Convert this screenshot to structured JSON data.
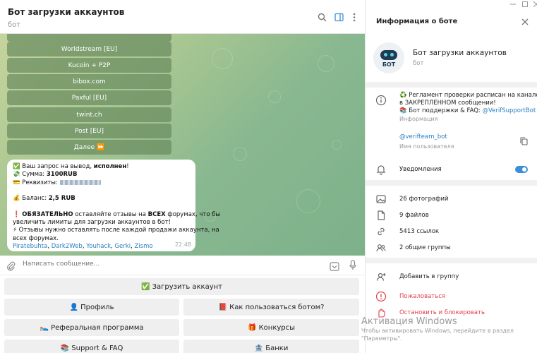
{
  "header": {
    "title": "Бот загрузки аккаунтов",
    "subtitle": "бот"
  },
  "inline_buttons": [
    "Worldstream [EU]",
    "Kucoin + P2P",
    "bibox.com",
    "Paxful [EU]",
    "twint.ch",
    "Post [EU]",
    "Далее ⏩"
  ],
  "message": {
    "line1_pre": "✅ Ваш запрос на вывод, ",
    "line1_bold": "исполнен",
    "line1_post": "!",
    "line2_pre": "💸 Сумма: ",
    "line2_bold": "3100RUB",
    "line3_pre": "💳 Реквизиты: ",
    "line4_pre": "💰 Баланс: ",
    "line4_bold": "2,5 RUB",
    "line5_pre": "❗ ",
    "line5_bold": "ОБЯЗАТЕЛЬНО",
    "line5_post": " оставляйте отзывы на ",
    "line5_bold2": "ВСЕХ",
    "line5_post2": " форумах, что бы",
    "line6": "увеличить лимиты для загрузки аккаунтов в бот!",
    "line7": "⚡ Отзывы нужно оставлять после каждой продажи аккаунта, на",
    "line8": "всех форумах.",
    "links": [
      "Piratebuhta",
      "Dark2Web",
      "Youhack",
      "Gerki",
      "Zismo"
    ],
    "time": "22:48"
  },
  "composer": {
    "placeholder": "Написать сообщение..."
  },
  "keyboard": {
    "upload": "✅ Загрузить аккаунт",
    "profile": "👤 Профиль",
    "howto": "📕 Как пользоваться ботом?",
    "referral": "🛌 Реферальная программа",
    "contests": "🎁 Конкурсы",
    "support": "📚 Support & FAQ",
    "banks": "🏦 Банки"
  },
  "info": {
    "title": "Информация о боте",
    "avatar_text": "БОТ",
    "name": "Бот загрузки аккаунтов",
    "kind": "бот",
    "about_line1": "♻️ Регламент проверки расписан на канале",
    "about_line2": "в ЗАКРЕПЛЕННОМ сообщении!",
    "about_line3_pre": "📚 Бот поддержки & FAQ: ",
    "about_line3_link": "@VerifSupportBot",
    "about_label": "Информация",
    "username": "@verifteam_bot",
    "username_label": "Имя пользователя",
    "notifications": "Уведомления",
    "notifications_on": true,
    "photos": "26 фотографий",
    "files": "9 файлов",
    "links": "5413 ссылок",
    "groups": "2 общие группы",
    "add_to_group": "Добавить в группу",
    "report": "Пожаловаться",
    "stop_block": "Остановить и блокировать"
  },
  "watermark": {
    "title": "Активация Windows",
    "text1": "Чтобы активировать Windows, перейдите в раздел",
    "text2": "\"Параметры\"."
  },
  "colors": {
    "accent": "#3a8fd8",
    "link": "#2a7ec1",
    "danger": "#e0404a",
    "inline_button": "#698c5f"
  }
}
